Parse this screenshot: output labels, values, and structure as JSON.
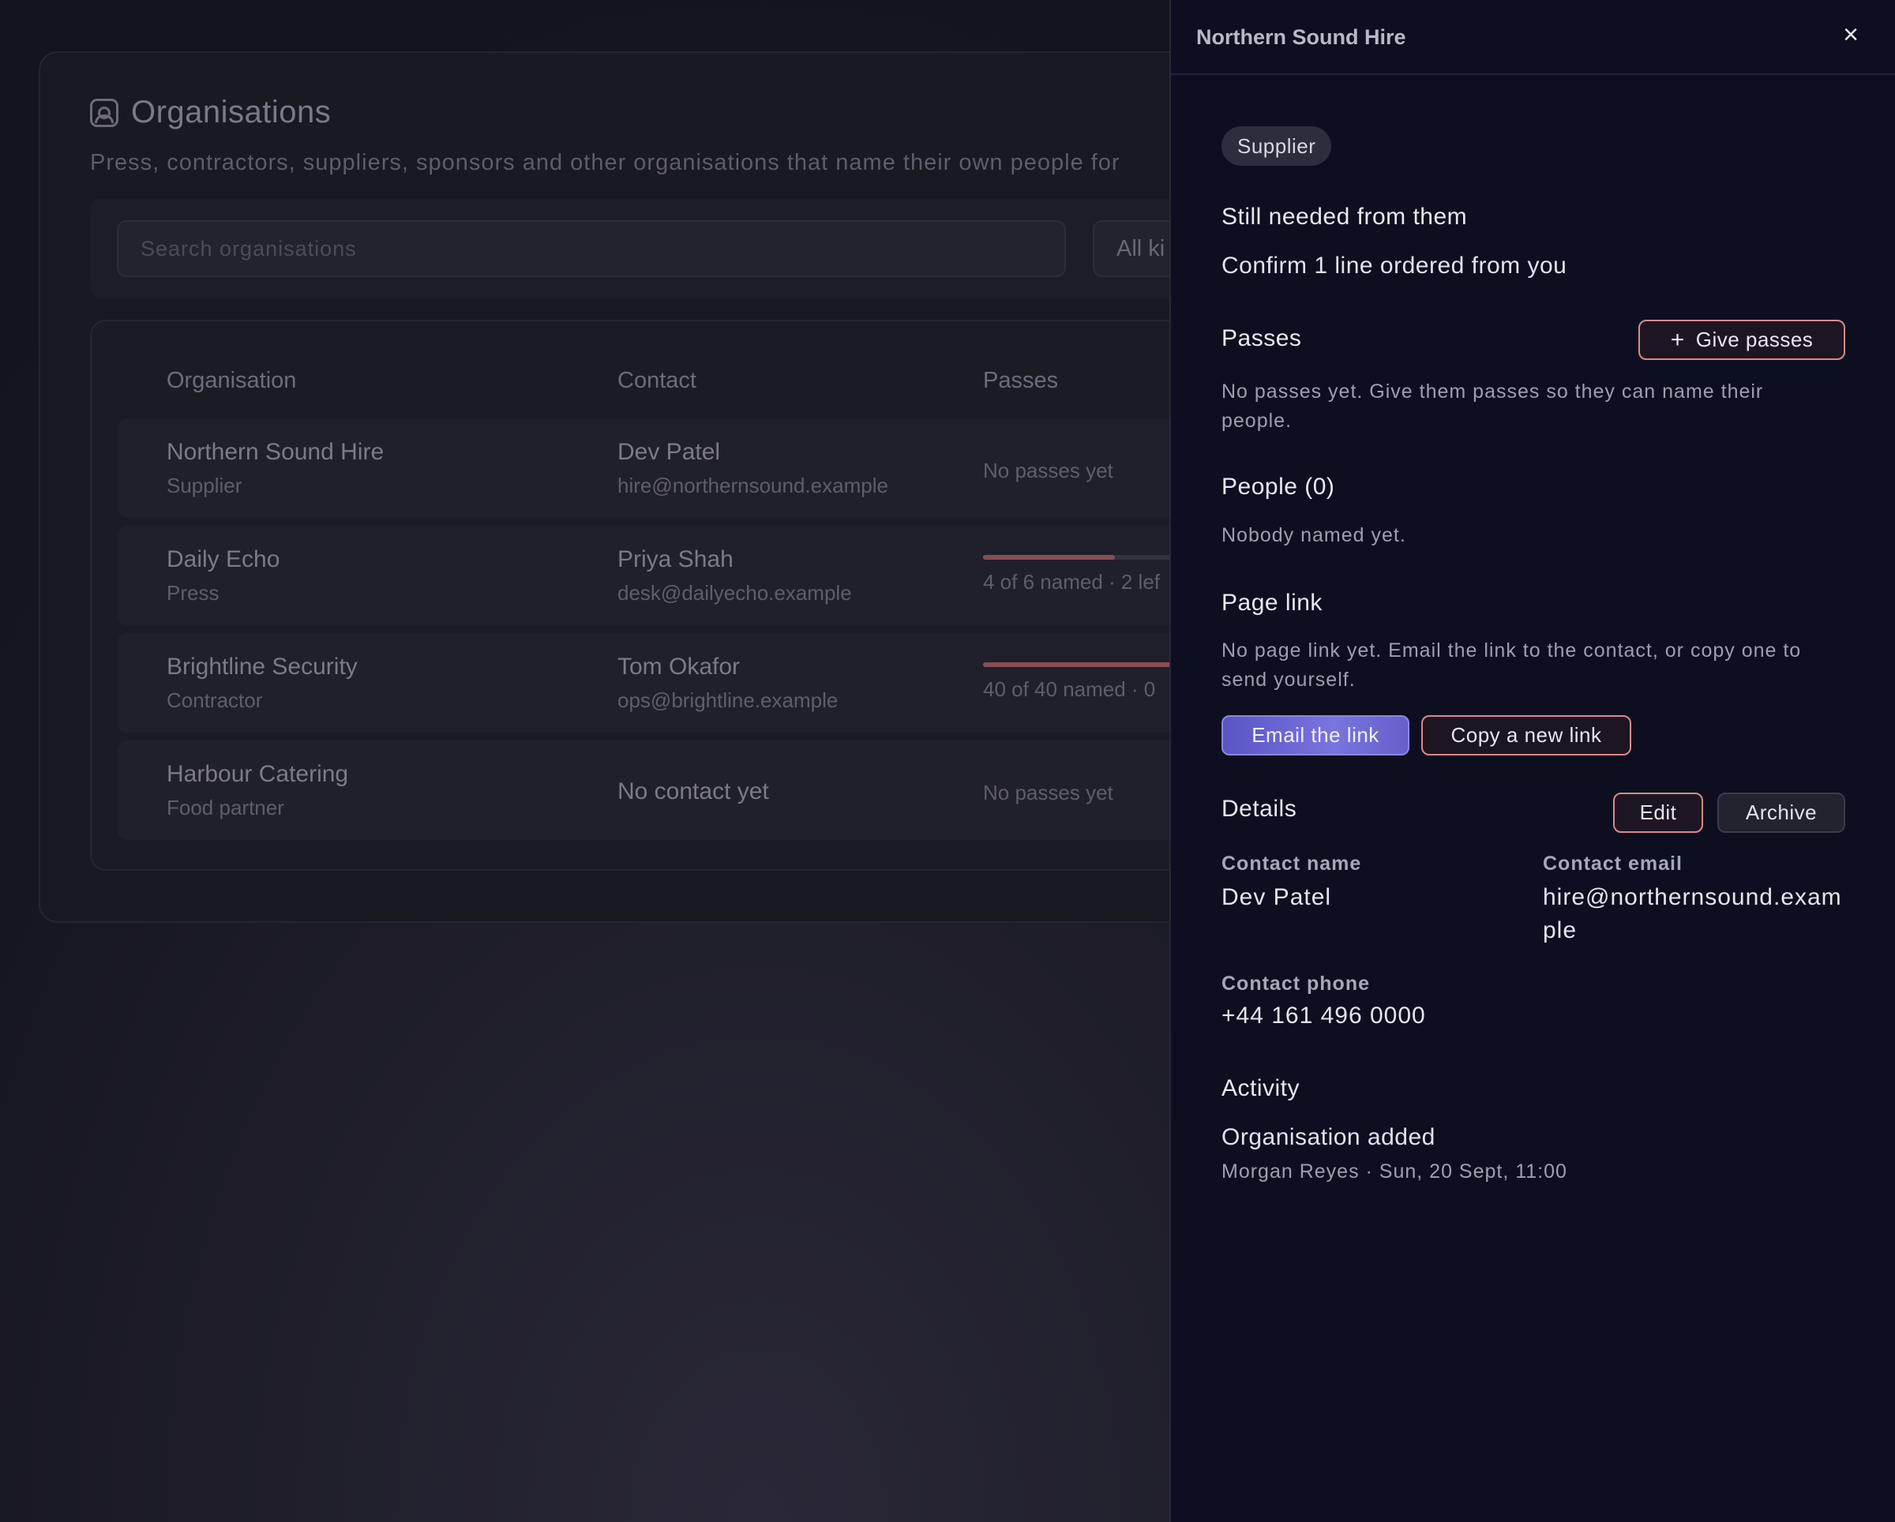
{
  "background": {
    "title": "Organisations",
    "subtitle": "Press, contractors, suppliers, sponsors and other organisations that name their own people for",
    "search_placeholder": "Search organisations",
    "kind_filter": "All ki",
    "columns": [
      "Organisation",
      "Contact",
      "Passes"
    ],
    "rows": [
      {
        "name": "Northern Sound Hire",
        "kind": "Supplier",
        "contact_name": "Dev Patel",
        "contact_email": "hire@northernsound.example",
        "passes_text": "No passes yet",
        "passes_fraction": null
      },
      {
        "name": "Daily Echo",
        "kind": "Press",
        "contact_name": "Priya Shah",
        "contact_email": "desk@dailyecho.example",
        "passes_text": "4 of 6 named · 2 lef",
        "passes_fraction": 0.667
      },
      {
        "name": "Brightline Security",
        "kind": "Contractor",
        "contact_name": "Tom Okafor",
        "contact_email": "ops@brightline.example",
        "passes_text": "40 of 40 named · 0",
        "passes_fraction": 1.0
      },
      {
        "name": "Harbour Catering",
        "kind": "Food partner",
        "contact_name": "No contact yet",
        "contact_email": "",
        "passes_text": "No passes yet",
        "passes_fraction": null
      }
    ]
  },
  "drawer": {
    "title": "Northern Sound Hire",
    "close_icon": "close-icon",
    "tag": "Supplier",
    "still_needed_heading": "Still needed from them",
    "still_needed_item": "Confirm 1 line ordered from you",
    "passes_heading": "Passes",
    "give_passes_label": "Give passes",
    "passes_text": "No passes yet. Give them passes so they can name their people.",
    "people_heading": "People (0)",
    "people_text": "Nobody named yet.",
    "page_link_heading": "Page link",
    "page_link_text": "No page link yet. Email the link to the contact, or copy one to send yourself.",
    "email_link_label": "Email the link",
    "copy_link_label": "Copy a new link",
    "details_heading": "Details",
    "edit_label": "Edit",
    "archive_label": "Archive",
    "contact_name_label": "Contact name",
    "contact_name_value": "Dev Patel",
    "contact_email_label": "Contact email",
    "contact_email_value": "hire@northernsound.example",
    "contact_phone_label": "Contact phone",
    "contact_phone_value": "+44 161 496 0000",
    "activity_heading": "Activity",
    "activity_title": "Organisation added",
    "activity_meta": "Morgan Reyes · Sun, 20 Sept, 11:00"
  },
  "colors": {
    "accent_primary": "#7a74de",
    "accent_outline": "#d98a8a",
    "drawer_bg": "#0d0f20"
  }
}
